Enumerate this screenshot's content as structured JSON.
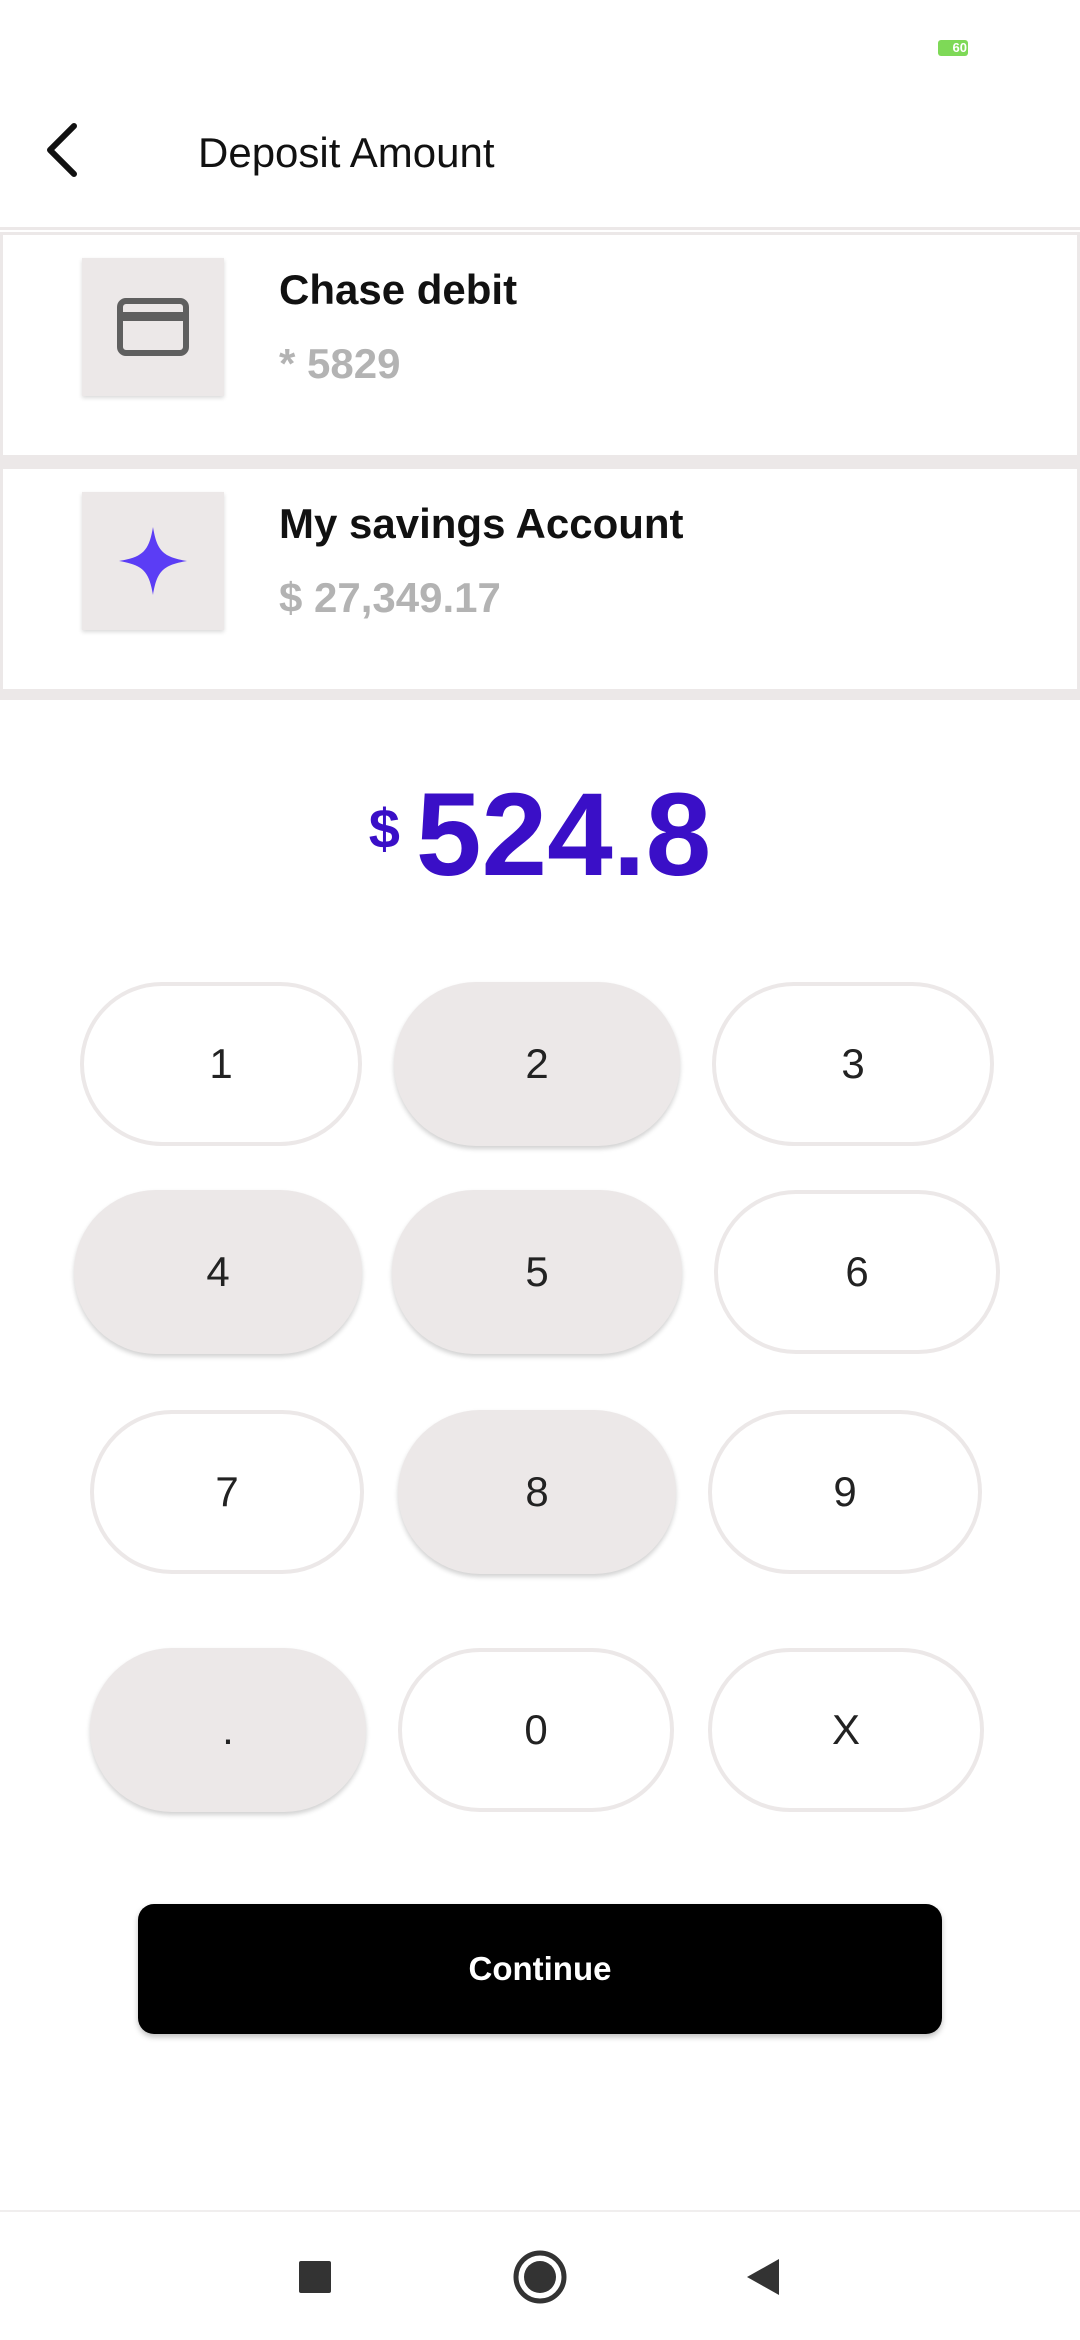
{
  "status_bar": {
    "battery_level": "60",
    "battery_color": "#7ed957"
  },
  "header": {
    "title": "Deposit Amount",
    "back_icon": "chevron-left-icon"
  },
  "accounts": [
    {
      "name": "Chase debit",
      "detail": "* 5829",
      "icon": "credit-card-icon"
    },
    {
      "name": "My savings Account",
      "detail": "$ 27,349.17",
      "icon": "sparkle-icon",
      "icon_color": "#5b3df5"
    }
  ],
  "amount": {
    "currency": "$",
    "value": "524.8",
    "color": "#3a0fc7"
  },
  "keypad": {
    "keys": [
      {
        "label": "1",
        "style": "outline"
      },
      {
        "label": "2",
        "style": "filled"
      },
      {
        "label": "3",
        "style": "outline"
      },
      {
        "label": "4",
        "style": "filled"
      },
      {
        "label": "5",
        "style": "filled"
      },
      {
        "label": "6",
        "style": "outline"
      },
      {
        "label": "7",
        "style": "outline"
      },
      {
        "label": "8",
        "style": "filled"
      },
      {
        "label": "9",
        "style": "outline"
      },
      {
        "label": ".",
        "style": "filled"
      },
      {
        "label": "0",
        "style": "outline"
      },
      {
        "label": "X",
        "style": "outline"
      }
    ]
  },
  "continue_label": "Continue",
  "nav": {
    "recents_icon": "square-icon",
    "home_icon": "circle-icon",
    "back_icon": "triangle-back-icon"
  }
}
